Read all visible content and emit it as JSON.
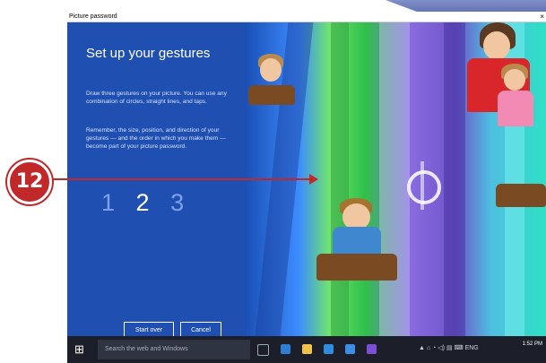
{
  "window": {
    "title": "Picture password",
    "close_glyph": "×"
  },
  "panel": {
    "heading": "Set up your gestures",
    "paragraph1": "Draw three gestures on your picture. You can use any combination of circles, straight lines, and taps.",
    "paragraph2": "Remember, the size, position, and direction of your gestures — and the order in which you make them — become part of your picture password.",
    "steps": [
      "1",
      "2",
      "3"
    ],
    "active_step": "2",
    "start_over_label": "Start over",
    "cancel_label": "Cancel"
  },
  "taskbar": {
    "search_placeholder": "Search the web and Windows",
    "language": "ENG",
    "time": "1:52 PM"
  },
  "callout": {
    "number": "12"
  },
  "colors": {
    "panel_bg": "#1f4fb0",
    "callout_red": "#c0282a",
    "taskbar_bg": "#1c1f2a"
  }
}
